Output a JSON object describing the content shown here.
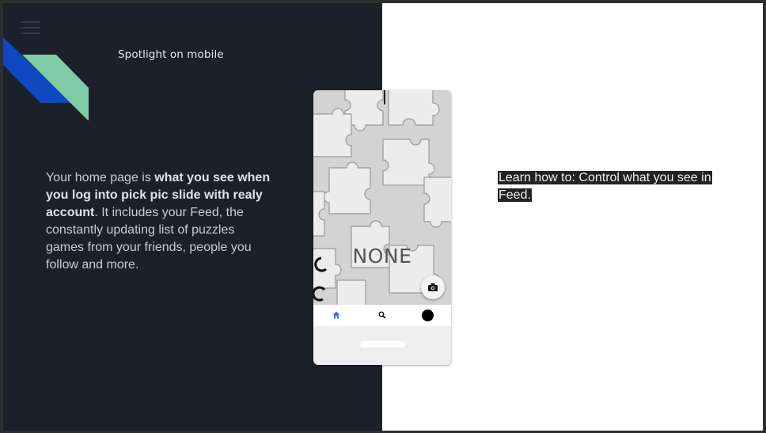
{
  "slide": {
    "heading": "Spotlight on mobile",
    "intro": {
      "lead": "Your home page is ",
      "bold": "what you see when you log into pick pic slide with realy account",
      "rest": ". It includes your Feed, the constantly updating list of puzzles games from your friends, people you follow and more."
    },
    "learn_text": "Learn how to: Control what you see in Feed."
  },
  "phone": {
    "overlay_text": "NONE",
    "nav": [
      "home-icon",
      "search-icon",
      "profile-avatar"
    ],
    "camera_icon": "camera-icon"
  },
  "colors": {
    "left_bg": "#1b202b",
    "brand_blue": "#0d47c2",
    "brand_green": "#7ecba6",
    "nav_active": "#3b78e7"
  }
}
